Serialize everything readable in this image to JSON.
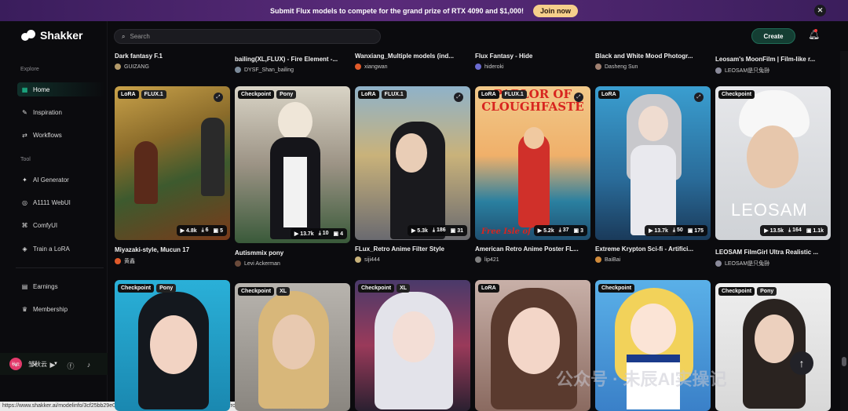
{
  "banner": {
    "text": "Submit Flux models to compete for the grand prize of RTX 4090 and $1,000!",
    "button": "Join now",
    "close": "✕"
  },
  "brand": {
    "name": "Shakker"
  },
  "sidebar": {
    "explore_label": "Explore",
    "explore_items": [
      {
        "label": "Home",
        "icon": "▦"
      },
      {
        "label": "Inspiration",
        "icon": "✎"
      },
      {
        "label": "Workflows",
        "icon": "⇄"
      }
    ],
    "tool_label": "Tool",
    "tool_items": [
      {
        "label": "AI Generator",
        "icon": "✦"
      },
      {
        "label": "A1111 WebUI",
        "icon": "◎"
      },
      {
        "label": "ComfyUI",
        "icon": "⌘"
      },
      {
        "label": "Train a LoRA",
        "icon": "◈"
      }
    ],
    "bottom_items": [
      {
        "label": "Earnings",
        "icon": "▤"
      },
      {
        "label": "Membership",
        "icon": "♛"
      }
    ],
    "user": {
      "name": "邹秋云",
      "avatar_text": "秋云"
    }
  },
  "statusbar": "https://www.shakker.ai/modelinfo/3cf25bb29e0144e4849064b122150054/Flux-Fantasy-Hide?from=feed",
  "search": {
    "placeholder": "Search"
  },
  "create_label": "Create",
  "row0": [
    {
      "title": "Dark fantasy F.1",
      "author": "GUIZANG"
    },
    {
      "title": "bailing(XL,FLUX) - Fire Element -...",
      "author": "DYSF_Shan_bailing"
    },
    {
      "title": "Wanxiang_Multiple models (ind...",
      "author": "xiangwan"
    },
    {
      "title": "Flux Fantasy - Hide",
      "author": "hideroki"
    },
    {
      "title": "Black and White Mood Photogr...",
      "author": "Dasheng Sun"
    },
    {
      "title": "Leosam's MoonFilm | Film-like r...",
      "author": "LEOSAM是只兔狲"
    }
  ],
  "row1": [
    {
      "tags": [
        "LoRA",
        "FLUX.1"
      ],
      "plays": "▶ 4.8k",
      "downloads": "⤓ 6",
      "images": "▣ 5",
      "title": "Miyazaki-style, Mucun 17",
      "author": "黄鑫"
    },
    {
      "tags": [
        "Checkpoint",
        "Pony"
      ],
      "plays": "▶ 13.7k",
      "downloads": "⤓ 10",
      "images": "▣ 4",
      "title": "Autismmix pony",
      "author": "Levi Ackerman"
    },
    {
      "tags": [
        "LoRA",
        "FLUX.1"
      ],
      "plays": "▶ 5.3k",
      "downloads": "⤓ 186",
      "images": "▣ 31",
      "title": "FLux_Retro Anime Filter Style",
      "author": "siji444"
    },
    {
      "tags": [
        "LoRA",
        "FLUX.1"
      ],
      "plays": "▶ 5.2k",
      "downloads": "⤓ 37",
      "images": "▣ 3",
      "title": "American Retro Anime Poster FL...",
      "author": "lip421",
      "poster_top": "PARLOR OF CLOUGHFASTE",
      "poster_bottom": "Free Isle of Three!"
    },
    {
      "tags": [
        "LoRA"
      ],
      "plays": "▶ 13.7k",
      "downloads": "⤓ 50",
      "images": "▣ 175",
      "title": "Extreme Krypton Sci-fi - Artifici...",
      "author": "BaiBai"
    },
    {
      "tags": [
        "Checkpoint"
      ],
      "plays": "▶ 13.5k",
      "downloads": "⤓ 164",
      "images": "▣ 1.1k",
      "title": "LEOSAM FilmGirl Ultra Realistic ...",
      "author": "LEOSAM是只兔狲",
      "overlay": "LEOSAM"
    }
  ],
  "row2": [
    {
      "tags": [
        "Checkpoint",
        "Pony"
      ]
    },
    {
      "tags": [
        "Checkpoint",
        "XL"
      ]
    },
    {
      "tags": [
        "Checkpoint",
        "XL"
      ]
    },
    {
      "tags": [
        "LoRA"
      ]
    },
    {
      "tags": [
        "Checkpoint"
      ]
    },
    {
      "tags": [
        "Checkpoint",
        "Pony"
      ]
    }
  ],
  "watermark": "公众号 · 未辰AI实操记",
  "colors": {
    "accent": "#20d6a2",
    "banner": "#4a2470",
    "join": "#f6cf8b"
  }
}
